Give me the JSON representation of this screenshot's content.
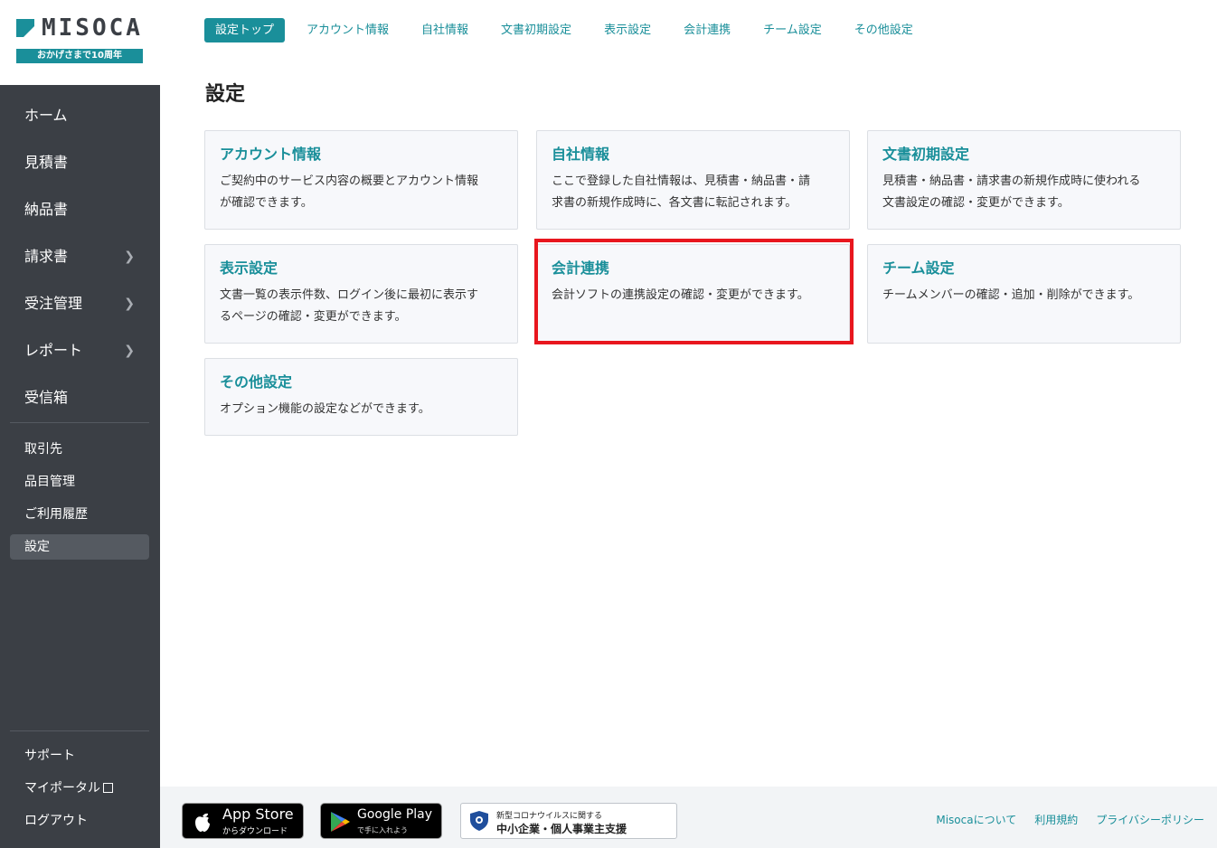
{
  "brand": {
    "logo_text": "MISOCA",
    "tagline": "おかげさまで10周年"
  },
  "sidebar": {
    "main_items": [
      {
        "label": "ホーム",
        "has_submenu": false
      },
      {
        "label": "見積書",
        "has_submenu": false
      },
      {
        "label": "納品書",
        "has_submenu": false
      },
      {
        "label": "請求書",
        "has_submenu": true
      },
      {
        "label": "受注管理",
        "has_submenu": true
      },
      {
        "label": "レポート",
        "has_submenu": true
      },
      {
        "label": "受信箱",
        "has_submenu": false
      }
    ],
    "sub_items": [
      {
        "label": "取引先"
      },
      {
        "label": "品目管理"
      },
      {
        "label": "ご利用履歴"
      },
      {
        "label": "設定",
        "active": true
      }
    ],
    "bottom_items": [
      {
        "label": "サポート"
      },
      {
        "label": "マイポータル"
      },
      {
        "label": "ログアウト"
      }
    ]
  },
  "tabs": [
    {
      "label": "設定トップ",
      "active": true
    },
    {
      "label": "アカウント情報"
    },
    {
      "label": "自社情報"
    },
    {
      "label": "文書初期設定"
    },
    {
      "label": "表示設定"
    },
    {
      "label": "会計連携"
    },
    {
      "label": "チーム設定"
    },
    {
      "label": "その他設定"
    }
  ],
  "page_title": "設定",
  "cards": [
    {
      "title": "アカウント情報",
      "desc_1": "ご契約中のサービス内容の概要とアカウント情報",
      "desc_2": "が確認できます。"
    },
    {
      "title": "自社情報",
      "desc_1": "ここで登録した自社情報は、見積書・納品書・請",
      "desc_2": "求書の新規作成時に、各文書に転記されます。"
    },
    {
      "title": "文書初期設定",
      "desc_1": "見積書・納品書・請求書の新規作成時に使われる",
      "desc_2": "文書設定の確認・変更ができます。"
    },
    {
      "title": "表示設定",
      "desc_1": "文書一覧の表示件数、ログイン後に最初に表示す",
      "desc_2": "るページの確認・変更ができます。"
    },
    {
      "title": "会計連携",
      "desc_1": "会計ソフトの連携設定の確認・変更ができます。",
      "desc_2": "",
      "highlighted": true
    },
    {
      "title": "チーム設定",
      "desc_1": "チームメンバーの確認・追加・削除ができます。",
      "desc_2": ""
    },
    {
      "title": "その他設定",
      "desc_1": "オプション機能の設定などができます。",
      "desc_2": ""
    }
  ],
  "footer": {
    "appstore_big": "App Store",
    "appstore_small": "からダウンロード",
    "googleplay_big": "Google Play",
    "googleplay_small": "で手に入れよう",
    "corona_line1": "新型コロナウイルスに関する",
    "corona_line2": "中小企業・個人事業主支援",
    "links": [
      "Misocaについて",
      "利用規約",
      "プライバシーポリシー"
    ]
  },
  "colors": {
    "accent": "#1a8f9a",
    "sidebar_bg": "#3b3f45",
    "highlight": "#e8161e"
  }
}
